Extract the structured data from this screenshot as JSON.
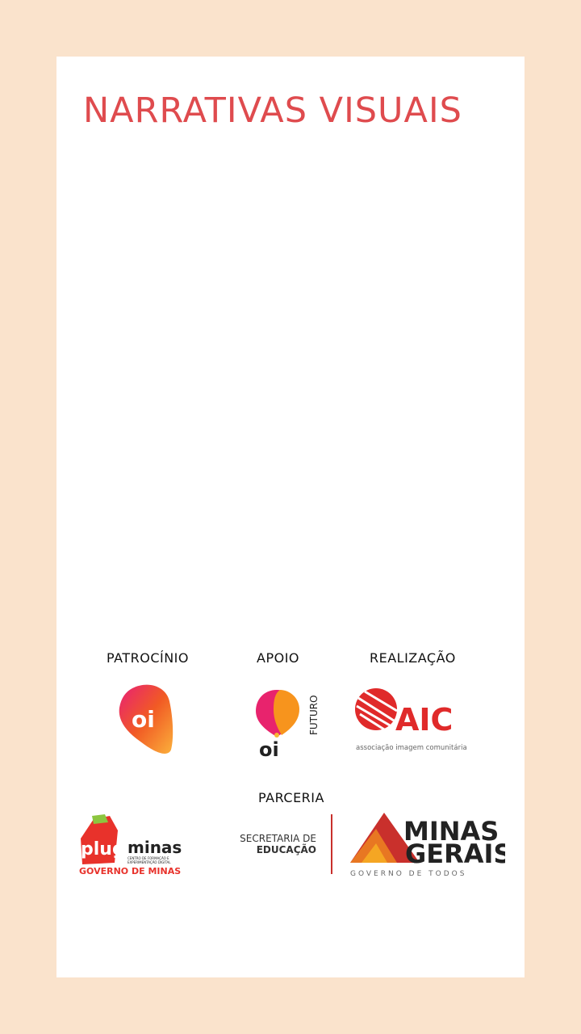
{
  "title": "NARRATIVAS VISUAIS",
  "sections": {
    "patrocinio": "PATROCÍNIO",
    "apoio": "APOIO",
    "realizacao": "REALIZAÇÃO",
    "parceria": "PARCERIA"
  },
  "logos": {
    "oi": {
      "text": "oi"
    },
    "oi_futuro": {
      "text": "oi",
      "side": "FUTURO"
    },
    "aic": {
      "text": "AIC",
      "sub": "associação imagem comunitária"
    },
    "plug_minas": {
      "plug": "plug",
      "minas": "minas",
      "tagline1": "CENTRO DE FORMAÇÃO E",
      "tagline2": "EXPERIMENTAÇÃO DIGITAL",
      "gov": "GOVERNO DE MINAS"
    },
    "minas_gerais": {
      "secretaria1": "SECRETARIA DE",
      "secretaria2": "EDUCAÇÃO",
      "minas": "MINAS",
      "gerais": "GERAIS",
      "gov": "GOVERNO DE TODOS"
    }
  },
  "colors": {
    "background": "#fae3cc",
    "card": "#ffffff",
    "title": "#df4b4e"
  }
}
